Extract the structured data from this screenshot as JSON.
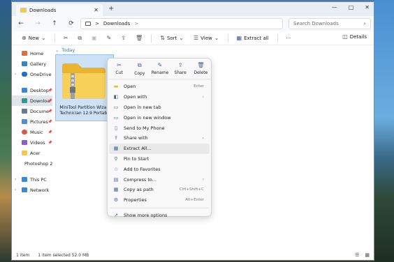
{
  "window": {
    "tab_title": "Downloads",
    "new_tab": "+",
    "controls": [
      "—",
      "□",
      "✕"
    ]
  },
  "nav": {
    "back": "←",
    "forward": "→",
    "up": "↑",
    "refresh": "⟳",
    "path": "Downloads",
    "path_sep": ">",
    "more": ">"
  },
  "search": {
    "placeholder": "Search Downloads",
    "icon": "search-icon"
  },
  "toolbar": {
    "new_label": "New",
    "sort_label": "Sort",
    "view_label": "View",
    "extract_label": "Extract all",
    "more_label": "···",
    "details_label": "Details"
  },
  "sidebar": {
    "items": [
      {
        "label": "Home",
        "color": "#e56b3a"
      },
      {
        "label": "Gallery",
        "color": "#3b82c4"
      },
      {
        "label": "OneDrive",
        "color": "#1f6fd6"
      },
      {
        "label": "Desktop",
        "color": "#3a8ad6"
      },
      {
        "label": "Downloa",
        "color": "#2a9d8f"
      },
      {
        "label": "Docume",
        "color": "#6b7a8f"
      },
      {
        "label": "Pictures",
        "color": "#4a90d9"
      },
      {
        "label": "Music",
        "color": "#e0554a"
      },
      {
        "label": "Videos",
        "color": "#8a5cd6"
      },
      {
        "label": "Acer",
        "color": "#f2c94c"
      },
      {
        "label": "Photoshop 2",
        "color": "#f2c94c"
      },
      {
        "label": "This PC",
        "color": "#3a8ad6"
      },
      {
        "label": "Network",
        "color": "#3a8ad6"
      }
    ]
  },
  "content": {
    "group": "Today",
    "file_name_line1": "MiniTool Partition Wizard",
    "file_name_line2": "Technician 12.9 Portable"
  },
  "context_menu": {
    "top_actions": [
      {
        "label": "Cut",
        "icon": "✂"
      },
      {
        "label": "Copy",
        "icon": "⧉"
      },
      {
        "label": "Rename",
        "icon": "✎"
      },
      {
        "label": "Share",
        "icon": "⇪"
      },
      {
        "label": "Delete",
        "icon": "🗑"
      }
    ],
    "items": [
      {
        "label": "Open",
        "shortcut": "Enter",
        "icon": "▬"
      },
      {
        "label": "Open with",
        "arrow": "›",
        "icon": "◧"
      },
      {
        "label": "Open in new tab",
        "icon": "▭"
      },
      {
        "label": "Open in new window",
        "icon": "▭"
      },
      {
        "label": "Send to My Phone",
        "icon": "▯"
      },
      {
        "label": "Share with",
        "arrow": "›",
        "icon": "⇪"
      },
      {
        "label": "Extract All...",
        "icon": "▦"
      },
      {
        "label": "Pin to Start",
        "icon": "⚲"
      },
      {
        "label": "Add to Favorites",
        "icon": "☆"
      },
      {
        "label": "Compress to...",
        "arrow": "›",
        "icon": "▤"
      },
      {
        "label": "Copy as path",
        "shortcut": "Ctrl+Shift+C",
        "icon": "▦"
      },
      {
        "label": "Properties",
        "shortcut": "Alt+Enter",
        "icon": "⚙"
      },
      {
        "label": "Show more options",
        "icon": "↗"
      }
    ]
  },
  "statusbar": {
    "items": "1 item",
    "selected": "1 item selected  52.0 MB"
  }
}
